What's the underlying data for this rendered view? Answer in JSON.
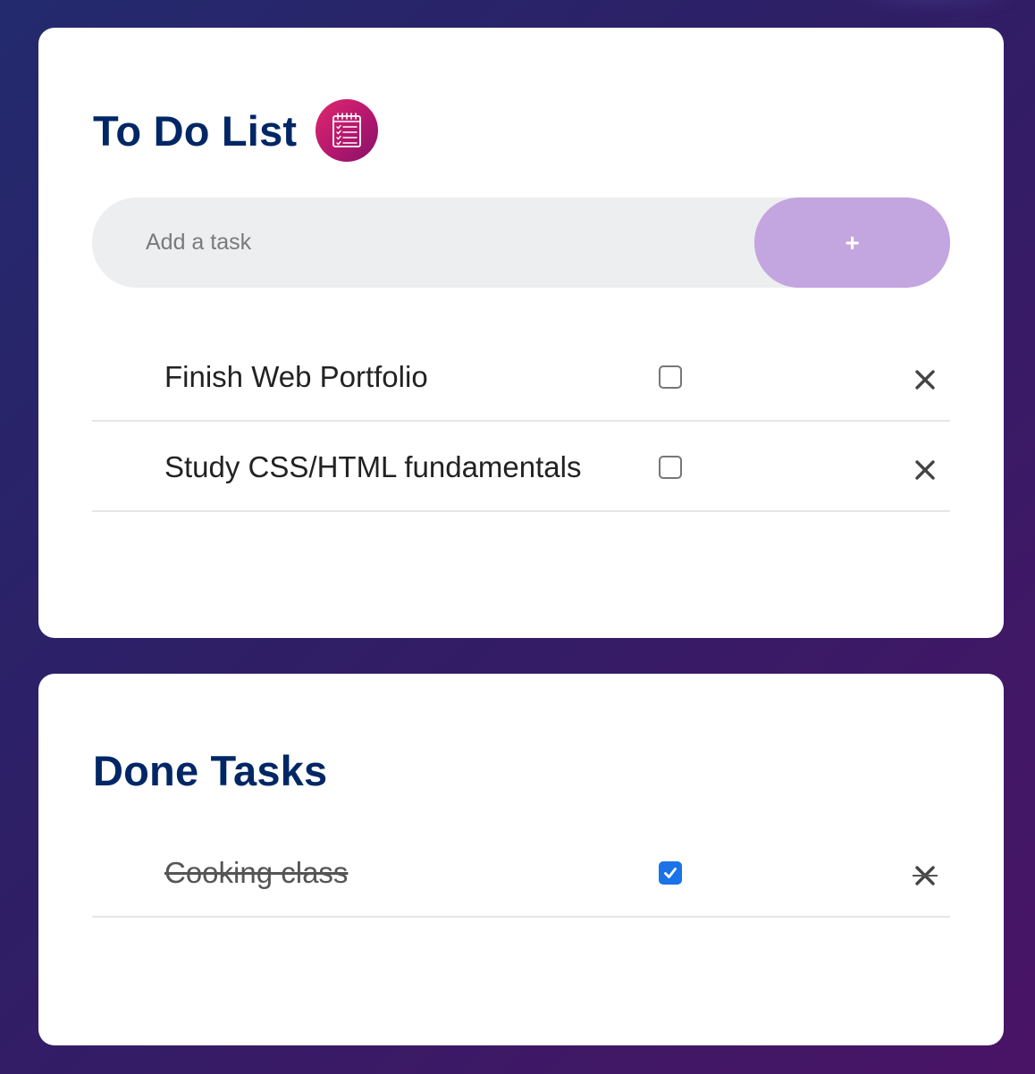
{
  "todo": {
    "title": "To Do List",
    "icon": "notepad-checklist-icon",
    "input": {
      "placeholder": "Add a task",
      "value": ""
    },
    "add_button_label": "+",
    "tasks": [
      {
        "text": "Finish Web Portfolio",
        "checked": false
      },
      {
        "text": "Study CSS/HTML fundamentals",
        "checked": false
      }
    ]
  },
  "done": {
    "title": "Done Tasks",
    "tasks": [
      {
        "text": "Cooking class",
        "checked": true
      }
    ]
  },
  "colors": {
    "title": "#002765",
    "add_button": "#c3a5df",
    "input_background": "#edeef0",
    "checkbox_checked": "#1a73e8",
    "icon_gradient_start": "#e0286e",
    "icon_gradient_end": "#86126a"
  }
}
